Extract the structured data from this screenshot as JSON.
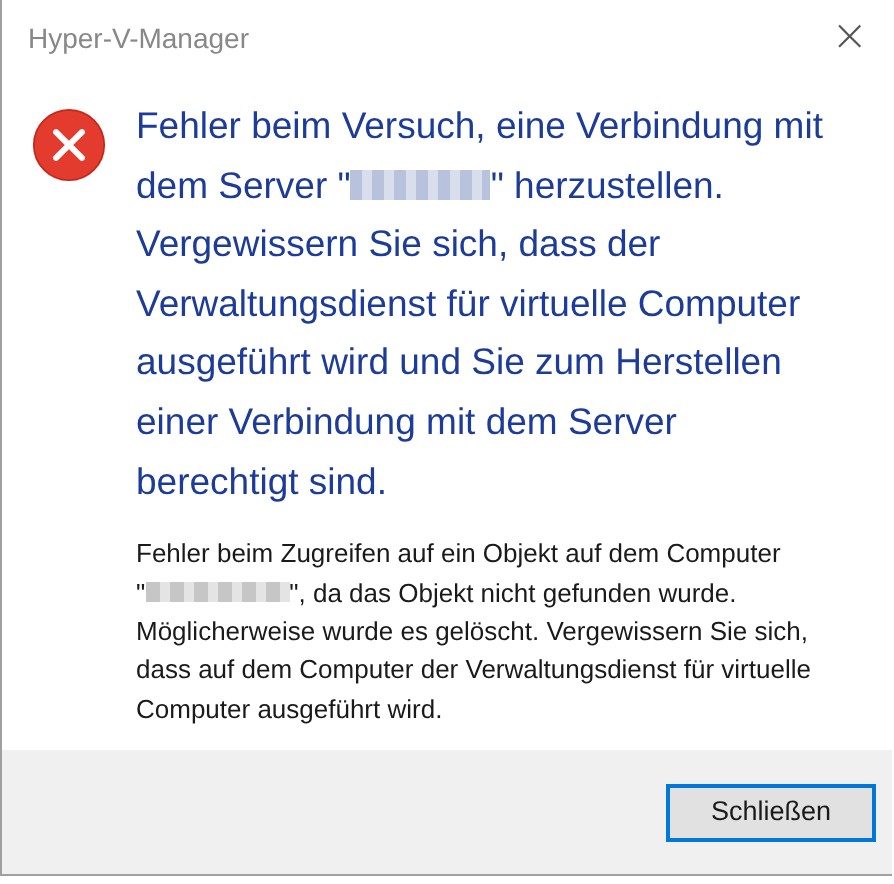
{
  "window": {
    "title": "Hyper-V-Manager",
    "close": "×"
  },
  "message": {
    "heading_line_1": "Fehler beim Versuch, eine Verbindung mit",
    "heading_before_name": "dem Server \"",
    "heading_after_name": "\" herzustellen.",
    "heading_rest": "Vergewissern Sie sich, dass der Verwaltungsdienst für virtuelle Computer ausgeführt wird und Sie zum Herstellen einer Verbindung mit dem Server berechtigt sind.",
    "detail_line_1": "Fehler beim Zugreifen auf ein Objekt auf dem Computer",
    "detail_before_name": "\"",
    "detail_after_name": "\", da das Objekt nicht gefunden wurde.",
    "detail_rest": "Möglicherweise wurde es gelöscht. Vergewissern Sie sich, dass auf dem Computer der Verwaltungsdienst für virtuelle Computer ausgeführt wird."
  },
  "buttons": [
    {
      "label": "Schließen",
      "selected": true
    }
  ]
}
